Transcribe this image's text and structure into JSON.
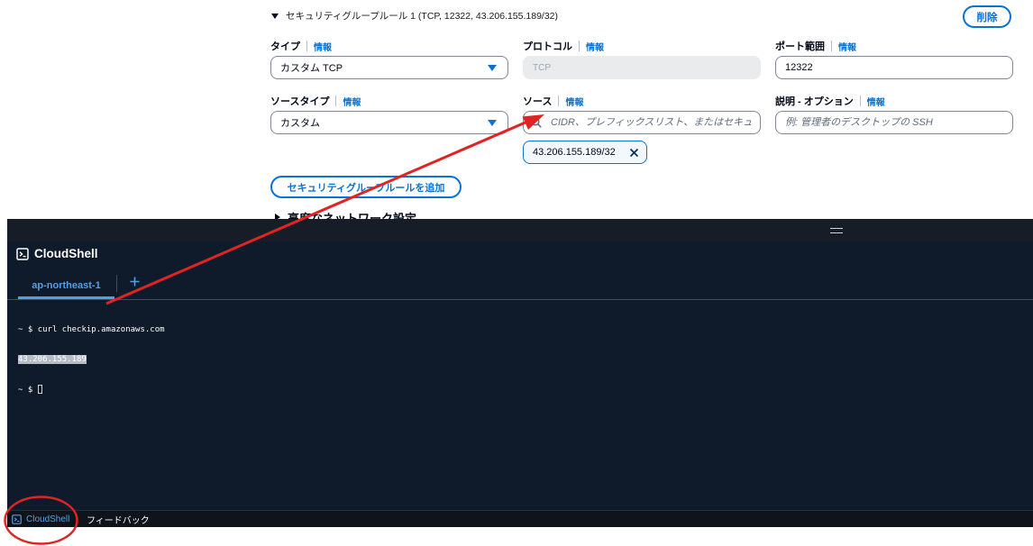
{
  "security_group_rule": {
    "title": "セキュリティグループルール 1 (TCP, 12322, 43.206.155.189/32)",
    "expanded": true,
    "delete_label": "削除",
    "info_label": "情報",
    "fields": {
      "type": {
        "label": "タイプ",
        "value": "カスタム TCP"
      },
      "protocol": {
        "label": "プロトコル",
        "value": "TCP",
        "disabled": true
      },
      "port_range": {
        "label": "ポート範囲",
        "value": "12322"
      },
      "source_type": {
        "label": "ソースタイプ",
        "value": "カスタム"
      },
      "source": {
        "label": "ソース",
        "placeholder": "CIDR、プレフィックスリスト、またはセキュ"
      },
      "description": {
        "label": "説明 - オプション",
        "placeholder": "例: 管理者のデスクトップの SSH"
      }
    },
    "source_tokens": [
      "43.206.155.189/32"
    ],
    "add_rule_label": "セキュリティグループルールを追加",
    "advanced_label": "高度なネットワーク設定"
  },
  "cloudshell": {
    "title": "CloudShell",
    "tabs": [
      {
        "label": "ap-northeast-1",
        "active": true
      }
    ],
    "terminal": {
      "lines": [
        {
          "prompt": "~ $ ",
          "text": "curl checkip.amazonaws.com"
        },
        {
          "text": "43.206.155.189",
          "selected": true
        },
        {
          "prompt": "~ $ ",
          "cursor": true
        }
      ]
    }
  },
  "footer": {
    "cloudshell_label": "CloudShell",
    "feedback_label": "フィードバック"
  },
  "colors": {
    "accent": "#0972d3",
    "terminal_background": "#0f1b2a",
    "active_tab": "#539fe5",
    "annotation": "#e02424"
  },
  "icons": {
    "rule_toggle": "caret-down-icon",
    "select_arrow": "caret-down-icon",
    "source_search": "search-icon",
    "token_remove": "close-icon",
    "advanced_toggle": "caret-right-icon",
    "resize_handle": "drag-handle-icon",
    "cloudshell": "terminal-icon",
    "add_tab": "plus-icon"
  }
}
